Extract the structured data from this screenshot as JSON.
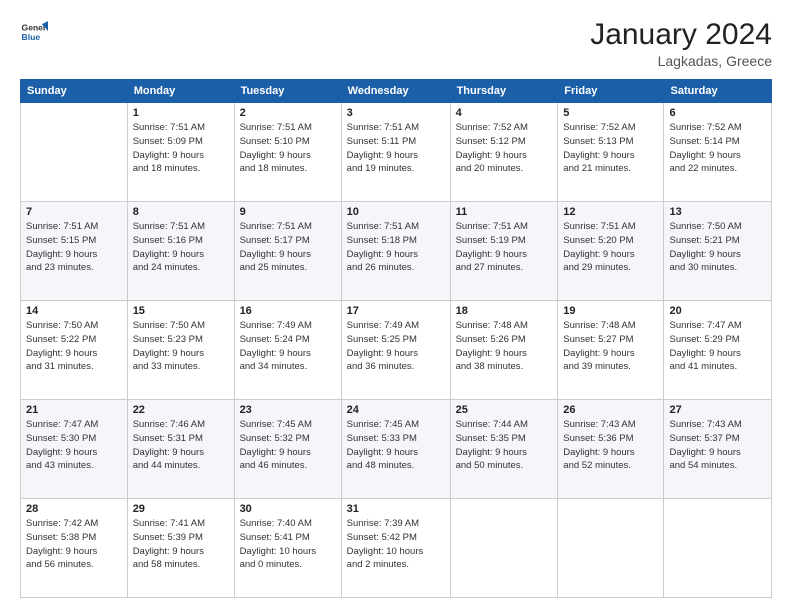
{
  "header": {
    "logo_line1": "General",
    "logo_line2": "Blue",
    "title": "January 2024",
    "subtitle": "Lagkadas, Greece"
  },
  "columns": [
    "Sunday",
    "Monday",
    "Tuesday",
    "Wednesday",
    "Thursday",
    "Friday",
    "Saturday"
  ],
  "weeks": [
    [
      {
        "day": "",
        "info": ""
      },
      {
        "day": "1",
        "info": "Sunrise: 7:51 AM\nSunset: 5:09 PM\nDaylight: 9 hours\nand 18 minutes."
      },
      {
        "day": "2",
        "info": "Sunrise: 7:51 AM\nSunset: 5:10 PM\nDaylight: 9 hours\nand 18 minutes."
      },
      {
        "day": "3",
        "info": "Sunrise: 7:51 AM\nSunset: 5:11 PM\nDaylight: 9 hours\nand 19 minutes."
      },
      {
        "day": "4",
        "info": "Sunrise: 7:52 AM\nSunset: 5:12 PM\nDaylight: 9 hours\nand 20 minutes."
      },
      {
        "day": "5",
        "info": "Sunrise: 7:52 AM\nSunset: 5:13 PM\nDaylight: 9 hours\nand 21 minutes."
      },
      {
        "day": "6",
        "info": "Sunrise: 7:52 AM\nSunset: 5:14 PM\nDaylight: 9 hours\nand 22 minutes."
      }
    ],
    [
      {
        "day": "7",
        "info": "Sunrise: 7:51 AM\nSunset: 5:15 PM\nDaylight: 9 hours\nand 23 minutes."
      },
      {
        "day": "8",
        "info": "Sunrise: 7:51 AM\nSunset: 5:16 PM\nDaylight: 9 hours\nand 24 minutes."
      },
      {
        "day": "9",
        "info": "Sunrise: 7:51 AM\nSunset: 5:17 PM\nDaylight: 9 hours\nand 25 minutes."
      },
      {
        "day": "10",
        "info": "Sunrise: 7:51 AM\nSunset: 5:18 PM\nDaylight: 9 hours\nand 26 minutes."
      },
      {
        "day": "11",
        "info": "Sunrise: 7:51 AM\nSunset: 5:19 PM\nDaylight: 9 hours\nand 27 minutes."
      },
      {
        "day": "12",
        "info": "Sunrise: 7:51 AM\nSunset: 5:20 PM\nDaylight: 9 hours\nand 29 minutes."
      },
      {
        "day": "13",
        "info": "Sunrise: 7:50 AM\nSunset: 5:21 PM\nDaylight: 9 hours\nand 30 minutes."
      }
    ],
    [
      {
        "day": "14",
        "info": "Sunrise: 7:50 AM\nSunset: 5:22 PM\nDaylight: 9 hours\nand 31 minutes."
      },
      {
        "day": "15",
        "info": "Sunrise: 7:50 AM\nSunset: 5:23 PM\nDaylight: 9 hours\nand 33 minutes."
      },
      {
        "day": "16",
        "info": "Sunrise: 7:49 AM\nSunset: 5:24 PM\nDaylight: 9 hours\nand 34 minutes."
      },
      {
        "day": "17",
        "info": "Sunrise: 7:49 AM\nSunset: 5:25 PM\nDaylight: 9 hours\nand 36 minutes."
      },
      {
        "day": "18",
        "info": "Sunrise: 7:48 AM\nSunset: 5:26 PM\nDaylight: 9 hours\nand 38 minutes."
      },
      {
        "day": "19",
        "info": "Sunrise: 7:48 AM\nSunset: 5:27 PM\nDaylight: 9 hours\nand 39 minutes."
      },
      {
        "day": "20",
        "info": "Sunrise: 7:47 AM\nSunset: 5:29 PM\nDaylight: 9 hours\nand 41 minutes."
      }
    ],
    [
      {
        "day": "21",
        "info": "Sunrise: 7:47 AM\nSunset: 5:30 PM\nDaylight: 9 hours\nand 43 minutes."
      },
      {
        "day": "22",
        "info": "Sunrise: 7:46 AM\nSunset: 5:31 PM\nDaylight: 9 hours\nand 44 minutes."
      },
      {
        "day": "23",
        "info": "Sunrise: 7:45 AM\nSunset: 5:32 PM\nDaylight: 9 hours\nand 46 minutes."
      },
      {
        "day": "24",
        "info": "Sunrise: 7:45 AM\nSunset: 5:33 PM\nDaylight: 9 hours\nand 48 minutes."
      },
      {
        "day": "25",
        "info": "Sunrise: 7:44 AM\nSunset: 5:35 PM\nDaylight: 9 hours\nand 50 minutes."
      },
      {
        "day": "26",
        "info": "Sunrise: 7:43 AM\nSunset: 5:36 PM\nDaylight: 9 hours\nand 52 minutes."
      },
      {
        "day": "27",
        "info": "Sunrise: 7:43 AM\nSunset: 5:37 PM\nDaylight: 9 hours\nand 54 minutes."
      }
    ],
    [
      {
        "day": "28",
        "info": "Sunrise: 7:42 AM\nSunset: 5:38 PM\nDaylight: 9 hours\nand 56 minutes."
      },
      {
        "day": "29",
        "info": "Sunrise: 7:41 AM\nSunset: 5:39 PM\nDaylight: 9 hours\nand 58 minutes."
      },
      {
        "day": "30",
        "info": "Sunrise: 7:40 AM\nSunset: 5:41 PM\nDaylight: 10 hours\nand 0 minutes."
      },
      {
        "day": "31",
        "info": "Sunrise: 7:39 AM\nSunset: 5:42 PM\nDaylight: 10 hours\nand 2 minutes."
      },
      {
        "day": "",
        "info": ""
      },
      {
        "day": "",
        "info": ""
      },
      {
        "day": "",
        "info": ""
      }
    ]
  ]
}
